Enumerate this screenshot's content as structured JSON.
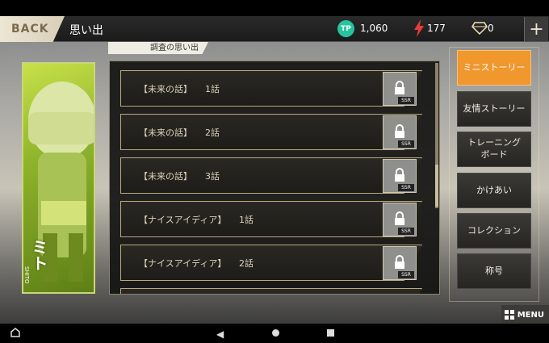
{
  "header": {
    "back_label": "BACK",
    "title": "思い出",
    "tp_icon_label": "TP",
    "tp_value": "1,060",
    "stamina_value": "177",
    "gem_value": "0",
    "plus_label": "+"
  },
  "subtab": "調査の思い出",
  "character": {
    "name": "ミト",
    "sub": "SHITO"
  },
  "stories": [
    {
      "label": "【未来の話】",
      "num": "1話",
      "rarity": "SSR"
    },
    {
      "label": "【未来の話】",
      "num": "2話",
      "rarity": "SSR"
    },
    {
      "label": "【未来の話】",
      "num": "3話",
      "rarity": "SSR"
    },
    {
      "label": "【ナイスアイディア】",
      "num": "1話",
      "rarity": "SSR"
    },
    {
      "label": "【ナイスアイディア】",
      "num": "2話",
      "rarity": "SSR"
    }
  ],
  "side_menu": [
    {
      "label": "ミニストーリー",
      "active": true
    },
    {
      "label": "友情ストーリー",
      "active": false
    },
    {
      "label": "トレーニング\nボード",
      "active": false
    },
    {
      "label": "かけあい",
      "active": false
    },
    {
      "label": "コレクション",
      "active": false
    },
    {
      "label": "称号",
      "active": false
    }
  ],
  "menu_label": "MENU",
  "colors": {
    "accent": "#f0972d",
    "tp": "#27c4a0",
    "stamina": "#e83a3a"
  }
}
